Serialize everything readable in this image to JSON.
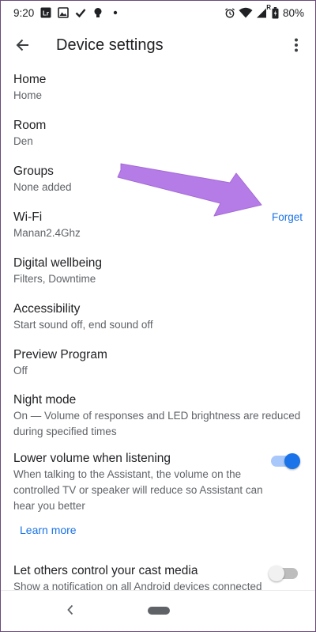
{
  "status_bar": {
    "time": "9:20",
    "left_icons": [
      "lightroom-icon",
      "photo-icon",
      "check-icon",
      "bulb-icon",
      "dot-icon"
    ],
    "right_icons": [
      "alarm-icon",
      "wifi-icon",
      "signal-icon",
      "battery-icon"
    ],
    "signal_label": "R",
    "battery": "80%"
  },
  "app_bar": {
    "title": "Device settings"
  },
  "settings": [
    {
      "title": "Home",
      "subtitle": "Home"
    },
    {
      "title": "Room",
      "subtitle": "Den"
    },
    {
      "title": "Groups",
      "subtitle": "None added"
    },
    {
      "title": "Wi-Fi",
      "subtitle": "Manan2.4Ghz",
      "action": "Forget"
    },
    {
      "title": "Digital wellbeing",
      "subtitle": "Filters, Downtime"
    },
    {
      "title": "Accessibility",
      "subtitle": "Start sound off, end sound off"
    },
    {
      "title": "Preview Program",
      "subtitle": "Off"
    },
    {
      "title": "Night mode",
      "subtitle": "On — Volume of responses and LED brightness are reduced during specified times"
    },
    {
      "title": "Lower volume when listening",
      "subtitle": "When talking to the Assistant, the volume on the controlled TV or speaker will reduce so Assistant can hear you better",
      "toggle": true,
      "link": "Learn more"
    },
    {
      "title": "Let others control your cast media",
      "subtitle": "Show a notification on all Android devices connected",
      "toggle": false
    }
  ],
  "colors": {
    "accent": "#1a73e8",
    "arrow": "#b57be6"
  }
}
